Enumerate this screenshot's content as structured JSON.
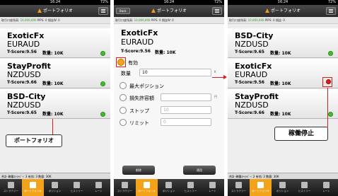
{
  "status": {
    "time": "16:24",
    "battery": "72%"
  },
  "nav": {
    "title": "ポートフォリオ",
    "back": "Back"
  },
  "info": {
    "label": "取引口座残高",
    "balance": "10,000,000",
    "pips": "PIPS: 0",
    "pl": "損益W: 0",
    "pl2": "損益: 0"
  },
  "portfolio": [
    {
      "name": "ExoticFx",
      "pair": "EURAUD",
      "score": "T-Score:9.56",
      "qty": "数量: 10K",
      "status": "green"
    },
    {
      "name": "StayProfit",
      "pair": "NZDUSD",
      "score": "T-Score:9.66",
      "qty": "数量: 10K",
      "status": "green"
    },
    {
      "name": "BSD-City",
      "pair": "NZDUSD",
      "score": "T-Score:9.65",
      "qty": "数量: 10K",
      "status": "green"
    }
  ],
  "portfolio_after": [
    {
      "name": "BSD-City",
      "pair": "NZDUSD",
      "score": "T-Score:9.65",
      "qty": "数量: 10K",
      "status": "green"
    },
    {
      "name": "ExoticFx",
      "pair": "EURAUD",
      "score": "T-Score:9.56",
      "qty": "数量: 10K",
      "status": "red"
    },
    {
      "name": "StayProfit",
      "pair": "NZDUSD",
      "score": "T-Score:9.66",
      "qty": "数量: 10K",
      "status": "green"
    }
  ],
  "detail": {
    "name": "ExoticFx",
    "pair": "EURAUD",
    "score": "T-Score:9.56",
    "qty": "数量: 10K",
    "enabled_label": "有効",
    "qty_label": "数量",
    "qty_value": "10",
    "qty_unit": "K",
    "max_position": "最大ポジション",
    "loss_limit": "損失許容額",
    "loss_unit": "円",
    "stop": "ストップ",
    "stop_value": "10",
    "limit": "リミット",
    "limit_value": "0",
    "delete": "削除",
    "apply": "適用"
  },
  "footer": {
    "p1": "合計  稼働ｽﾄﾗﾃｼﾞｰ: 3  有効: 3  数量: 30K",
    "p3": "合計  稼働ｽﾄﾗﾃｼﾞｰ: 2  有効: 2  数量: 30K"
  },
  "tabs": [
    "ストラテジー",
    "ポートフォリオ",
    "ポジション",
    "ヒストリー",
    "レート"
  ],
  "callouts": {
    "portfolio": "ポートフォリオ",
    "stopped": "稼働停止"
  },
  "colors": {
    "accent": "#f2a319",
    "running": "#3fbf2a",
    "stopped": "#e01a1a"
  }
}
